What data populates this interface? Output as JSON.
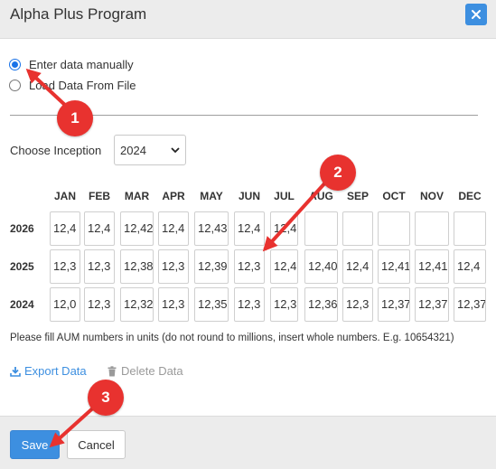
{
  "dialog": {
    "title": "Alpha Plus Program",
    "close_icon": "close-icon"
  },
  "source": {
    "options": [
      {
        "label": "Enter data manually",
        "checked": true
      },
      {
        "label": "Load Data From File",
        "checked": false
      }
    ]
  },
  "inception": {
    "label": "Choose Inception",
    "value": "2024"
  },
  "grid": {
    "months": [
      "JAN",
      "FEB",
      "MAR",
      "APR",
      "MAY",
      "JUN",
      "JUL",
      "AUG",
      "SEP",
      "OCT",
      "NOV",
      "DEC"
    ],
    "rows": [
      {
        "year": "2026",
        "values": [
          "12,4",
          "12,4",
          "12,42",
          "12,4",
          "12,43",
          "12,4",
          "12,4",
          "",
          "",
          "",
          "",
          ""
        ]
      },
      {
        "year": "2025",
        "values": [
          "12,3",
          "12,3",
          "12,38",
          "12,3",
          "12,39",
          "12,3",
          "12,4",
          "12,40",
          "12,4",
          "12,41",
          "12,41",
          "12,4"
        ]
      },
      {
        "year": "2024",
        "values": [
          "12,0",
          "12,3",
          "12,32",
          "12,3",
          "12,35",
          "12,3",
          "12,3",
          "12,36",
          "12,3",
          "12,37",
          "12,37",
          "12,37"
        ]
      }
    ]
  },
  "note": "Please fill AUM numbers in units (do not round to millions, insert whole numbers. E.g. 10654321)",
  "actions": {
    "export_label": "Export Data",
    "delete_label": "Delete Data"
  },
  "footer": {
    "save_label": "Save",
    "cancel_label": "Cancel"
  },
  "annotations": {
    "badges": [
      "1",
      "2",
      "3"
    ],
    "color": "#e8322f"
  },
  "colors": {
    "accent": "#3d8fe0",
    "header_bg": "#ececec"
  }
}
